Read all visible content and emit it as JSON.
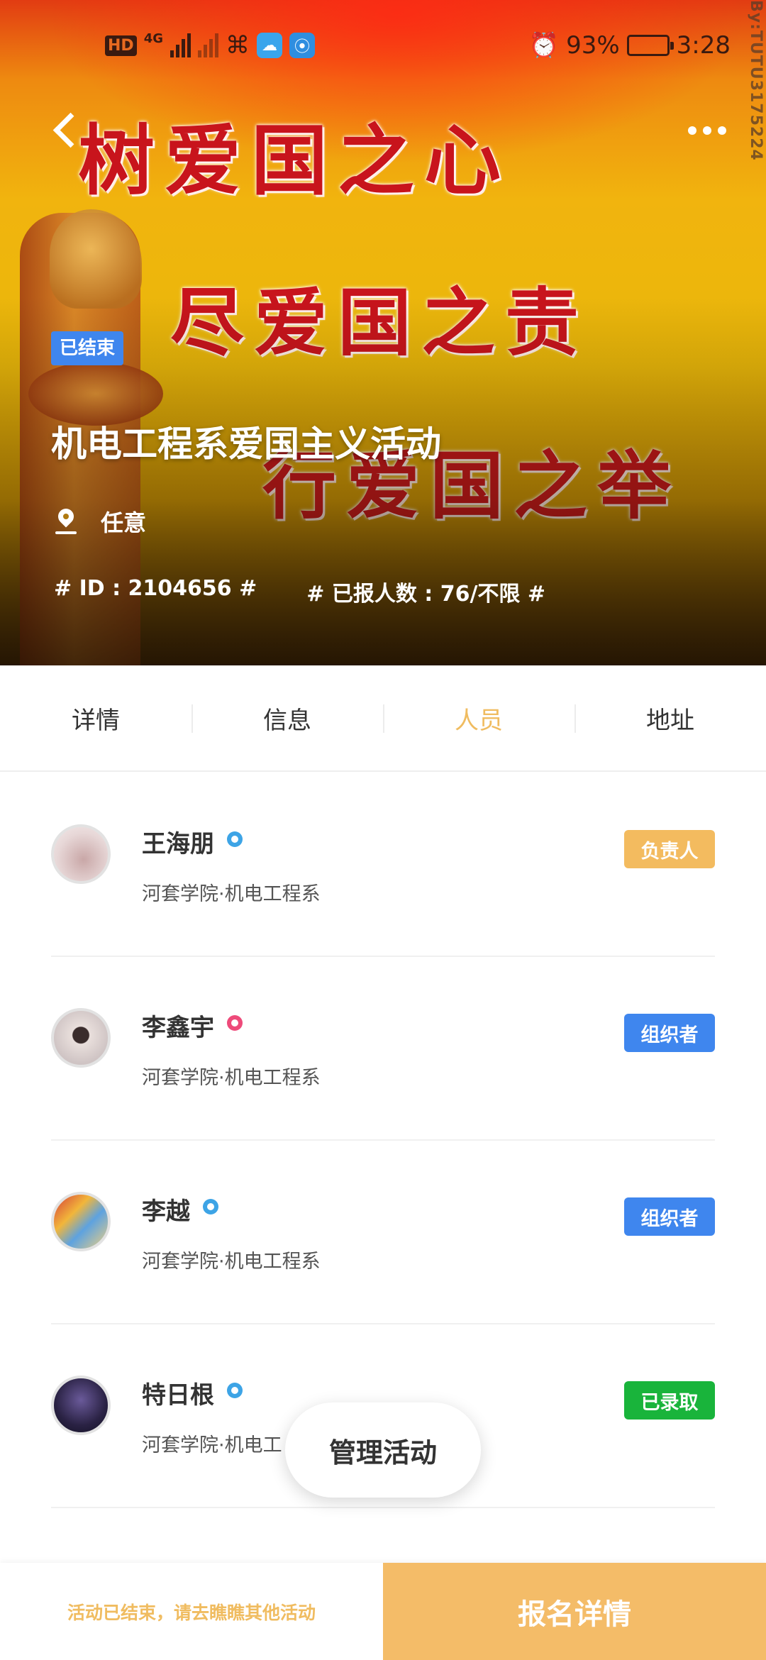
{
  "status_bar": {
    "hd": "HD",
    "network": "4G",
    "battery_percent": "93%",
    "battery_level": 0.93,
    "time": "3:28"
  },
  "watermark": "By:TUTU3175224",
  "hero": {
    "slogan_lines": [
      "树爱国之心",
      "尽爱国之责",
      "行爱国之举"
    ],
    "status_tag": "已结束",
    "title": "机电工程系爱国主义活动",
    "location": "任意",
    "id_text": "# ID : 2104656 #",
    "count_text": "# 已报人数 : 76/不限 #"
  },
  "tabs": [
    {
      "label": "详情",
      "active": false
    },
    {
      "label": "信息",
      "active": false
    },
    {
      "label": "人员",
      "active": true
    },
    {
      "label": "地址",
      "active": false
    }
  ],
  "members": [
    {
      "name": "王海朋",
      "dept": "河套学院·机电工程系",
      "role": "负责人",
      "role_color": "#f3bb5f",
      "badge_color": "blue"
    },
    {
      "name": "李鑫宇",
      "dept": "河套学院·机电工程系",
      "role": "组织者",
      "role_color": "#3f86ee",
      "badge_color": "pink"
    },
    {
      "name": "李越",
      "dept": "河套学院·机电工程系",
      "role": "组织者",
      "role_color": "#3f86ee",
      "badge_color": "blue"
    },
    {
      "name": "特日根",
      "dept": "河套学院·机电工",
      "role": "已录取",
      "role_color": "#19b43b",
      "badge_color": "blue"
    }
  ],
  "manage_button": "管理活动",
  "bottom": {
    "tip": "活动已结束，请去瞧瞧其他活动",
    "action": "报名详情"
  }
}
